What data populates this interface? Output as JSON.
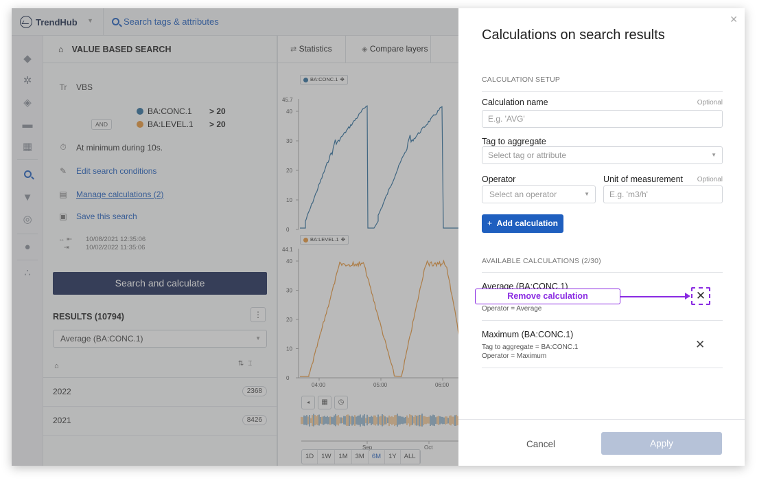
{
  "app": {
    "brand": "TrendHub",
    "search_placeholder": "Search tags & attributes"
  },
  "rail": {
    "icons": [
      "tag-icon",
      "filter-ai-icon",
      "layers-icon",
      "comment-icon",
      "dashboard-icon",
      "search-icon",
      "funnel-icon",
      "fingerprint-icon",
      "bulb-icon",
      "scatter-icon"
    ]
  },
  "left_panel": {
    "header": "VALUE BASED SEARCH",
    "search_name": "VBS",
    "conditions": [
      {
        "tag": "BA:CONC.1",
        "color": "#2e6f9e",
        "threshold": "> 20"
      },
      {
        "tag": "BA:LEVEL.1",
        "color": "#e8963a",
        "threshold": "> 20"
      }
    ],
    "operator": "AND",
    "duration": "At minimum during 10s.",
    "edit_conditions": "Edit search conditions",
    "manage_calculations": "Manage calculations (2)",
    "save_search": "Save this search",
    "date_from": "10/08/2021 12:35:06",
    "date_to": "10/02/2022 11:35:06",
    "search_button": "Search and calculate",
    "results_title": "RESULTS (10794)",
    "results_select": "Average (BA:CONC.1)",
    "rows": [
      {
        "year": "2022",
        "count": "2368"
      },
      {
        "year": "2021",
        "count": "8426"
      }
    ]
  },
  "chart_tabs": {
    "statistics": "Statistics",
    "compare_layers": "Compare layers"
  },
  "charts": {
    "top": {
      "chip": "BA:CONC.1",
      "color": "#2e6f9e",
      "y_max_label": "45.7",
      "y_ticks": [
        "40",
        "30",
        "20",
        "10",
        "0"
      ]
    },
    "bottom": {
      "chip": "BA:LEVEL.1",
      "color": "#e8963a",
      "y_max_label": "44.1",
      "y_ticks": [
        "40",
        "30",
        "20",
        "10",
        "0"
      ],
      "x_ticks": [
        "04:00",
        "05:00",
        "06:00"
      ]
    },
    "overview_ticks": [
      "Sep",
      "Oct"
    ],
    "range_buttons": [
      "1D",
      "1W",
      "1M",
      "3M",
      "6M",
      "1Y",
      "ALL"
    ],
    "range_active": "6M"
  },
  "modal": {
    "title": "Calculations on search results",
    "setup_title": "CALCULATION SETUP",
    "name_label": "Calculation name",
    "optional": "Optional",
    "name_placeholder": "E.g. 'AVG'",
    "tag_label": "Tag to aggregate",
    "tag_placeholder": "Select tag or attribute",
    "operator_label": "Operator",
    "operator_placeholder": "Select an operator",
    "unit_label": "Unit of measurement",
    "unit_placeholder": "E.g. 'm3/h'",
    "add_button": "Add calculation",
    "available_title": "AVAILABLE CALCULATIONS (2/30)",
    "calculations": [
      {
        "name": "Average (BA:CONC.1)",
        "tag": "",
        "operator": "Operator = Average"
      },
      {
        "name": "Maximum (BA:CONC.1)",
        "tag": "Tag to aggregate = BA:CONC.1",
        "operator": "Operator = Maximum"
      }
    ],
    "callout": "Remove calculation",
    "cancel": "Cancel",
    "apply": "Apply"
  }
}
